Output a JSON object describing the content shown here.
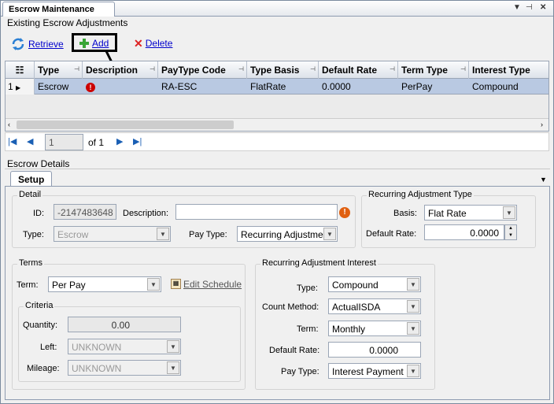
{
  "window": {
    "tab_title": "Escrow Maintenance"
  },
  "existing": {
    "title": "Existing Escrow Adjustments",
    "toolbar": {
      "retrieve": "Retrieve",
      "add": "Add",
      "delete": "Delete"
    },
    "columns": [
      "Type",
      "Description",
      "PayType Code",
      "Type Basis",
      "Default Rate",
      "Term Type",
      "Interest Type"
    ],
    "row": {
      "num": "1",
      "type": "Escrow",
      "paytype_code": "RA-ESC",
      "type_basis": "FlatRate",
      "default_rate": "0.0000",
      "term_type": "PerPay",
      "interest_type": "Compound"
    },
    "pager": {
      "page": "1",
      "of_label": "of 1"
    }
  },
  "details": {
    "title": "Escrow Details",
    "tab": "Setup",
    "detail": {
      "title": "Detail",
      "id_label": "ID:",
      "id_value": "-2147483648",
      "description_label": "Description:",
      "description_value": "",
      "type_label": "Type:",
      "type_value": "Escrow",
      "paytype_label": "Pay Type:",
      "paytype_value": "Recurring Adjustmen"
    },
    "recurring_type": {
      "title": "Recurring Adjustment Type",
      "basis_label": "Basis:",
      "basis_value": "Flat Rate",
      "rate_label": "Default Rate:",
      "rate_value": "0.0000"
    },
    "terms": {
      "title": "Terms",
      "term_label": "Term:",
      "term_value": "Per Pay",
      "edit_schedule": "Edit Schedule",
      "criteria": {
        "title": "Criteria",
        "quantity_label": "Quantity:",
        "quantity_value": "0.00",
        "left_label": "Left:",
        "left_value": "UNKNOWN",
        "mileage_label": "Mileage:",
        "mileage_value": "UNKNOWN"
      }
    },
    "interest": {
      "title": "Recurring Adjustment Interest",
      "type_label": "Type:",
      "type_value": "Compound",
      "count_label": "Count Method:",
      "count_value": "ActualISDA",
      "term_label": "Term:",
      "term_value": "Monthly",
      "rate_label": "Default Rate:",
      "rate_value": "0.0000",
      "paytype_label": "Pay Type:",
      "paytype_value": "Interest Payment"
    }
  },
  "colors": {
    "selection": "#b9c9e2",
    "link": "#0000cc",
    "callout": "#000000",
    "error": "#cc0000"
  }
}
